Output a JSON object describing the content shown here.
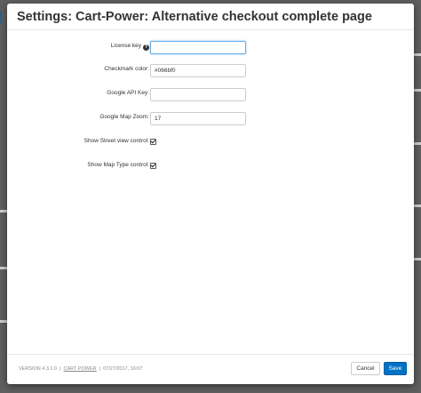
{
  "modal": {
    "title": "Settings: Cart-Power: Alternative checkout complete page",
    "fields": {
      "license_key": {
        "label": "License key",
        "value": ""
      },
      "checkmark_color": {
        "label": "Checkmark color:",
        "value": "#066bf0"
      },
      "google_api_key": {
        "label": "Google API Key:",
        "value": ""
      },
      "google_map_zoom": {
        "label": "Google Map Zoom:",
        "value": "17"
      },
      "show_street_view": {
        "label": "Show Street view control:",
        "checked": true
      },
      "show_map_type": {
        "label": "Show Map Type control:",
        "checked": true
      }
    },
    "footer": {
      "version": "VERSION 4.3.1.0",
      "vendor": "CART POWER",
      "date": "07/27/2017, 16:07",
      "cancel_label": "Cancel",
      "save_label": "Save"
    }
  },
  "colors": {
    "overlay": "#5f5f5f",
    "primary": "#0072c6",
    "focus": "#66afe9"
  }
}
